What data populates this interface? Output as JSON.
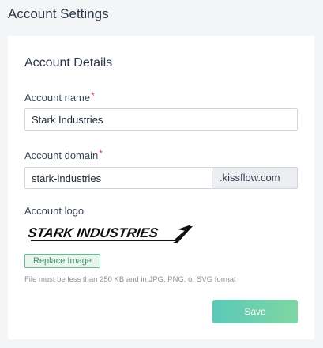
{
  "page": {
    "title": "Account Settings"
  },
  "card": {
    "section_title": "Account Details",
    "account_name": {
      "label": "Account name",
      "required_mark": "*",
      "value": "Stark Industries"
    },
    "account_domain": {
      "label": "Account domain",
      "required_mark": "*",
      "value": "stark-industries",
      "suffix": ".kissflow.com"
    },
    "account_logo": {
      "label": "Account logo",
      "logo_text": "STARK INDUSTRIES",
      "replace_button": "Replace Image",
      "hint": "File must be less than 250 KB and in JPG, PNG, or SVG format"
    },
    "save_button": "Save"
  },
  "colors": {
    "required": "#e0414c",
    "accent_start": "#5cc9b8",
    "accent_end": "#7ed6a3",
    "replace_border": "#5fbf92"
  }
}
